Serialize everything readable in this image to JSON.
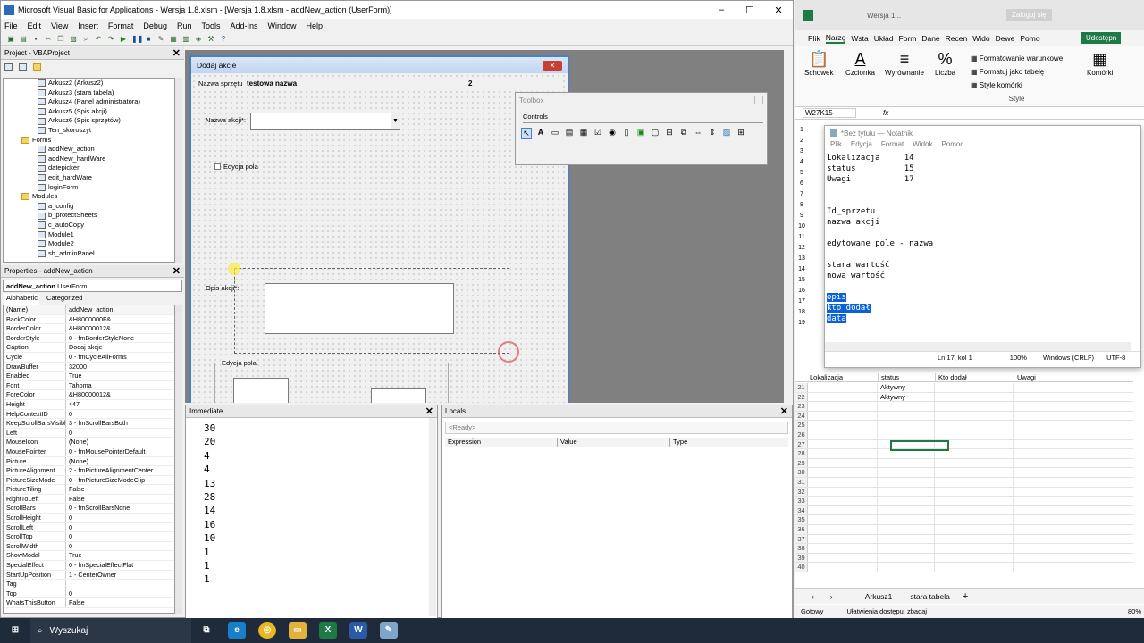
{
  "vba": {
    "title": "Microsoft Visual Basic for Applications - Wersja 1.8.xlsm - [Wersja 1.8.xlsm - addNew_action (UserForm)]",
    "menu": [
      "File",
      "Edit",
      "View",
      "Insert",
      "Format",
      "Debug",
      "Run",
      "Tools",
      "Add-Ins",
      "Window",
      "Help"
    ],
    "project": {
      "title": "Project - VBAProject",
      "items": [
        {
          "label": "Arkusz2 (Arkusz2)",
          "level": 2,
          "folder": false
        },
        {
          "label": "Arkusz3 (stara tabela)",
          "level": 2,
          "folder": false
        },
        {
          "label": "Arkusz4 (Panel administratora)",
          "level": 2,
          "folder": false
        },
        {
          "label": "Arkusz5 (Spis akcji)",
          "level": 2,
          "folder": false
        },
        {
          "label": "Arkusz6 (Spis sprzętów)",
          "level": 2,
          "folder": false
        },
        {
          "label": "Ten_skoroszyt",
          "level": 2,
          "folder": false
        },
        {
          "label": "Forms",
          "level": 1,
          "folder": true
        },
        {
          "label": "addNew_action",
          "level": 2,
          "folder": false
        },
        {
          "label": "addNew_hardWare",
          "level": 2,
          "folder": false
        },
        {
          "label": "datepicker",
          "level": 2,
          "folder": false
        },
        {
          "label": "edit_hardWare",
          "level": 2,
          "folder": false
        },
        {
          "label": "loginForm",
          "level": 2,
          "folder": false
        },
        {
          "label": "Modules",
          "level": 1,
          "folder": true
        },
        {
          "label": "a_config",
          "level": 2,
          "folder": false
        },
        {
          "label": "b_protectSheets",
          "level": 2,
          "folder": false
        },
        {
          "label": "c_autoCopy",
          "level": 2,
          "folder": false
        },
        {
          "label": "Module1",
          "level": 2,
          "folder": false
        },
        {
          "label": "Module2",
          "level": 2,
          "folder": false
        },
        {
          "label": "sh_adminPanel",
          "level": 2,
          "folder": false
        }
      ]
    },
    "properties": {
      "title": "Properties - addNew_action",
      "object_name": "addNew_action",
      "object_type": "UserForm",
      "tabs": [
        "Alphabetic",
        "Categorized"
      ],
      "rows": [
        [
          "(Name)",
          "addNew_action"
        ],
        [
          "BackColor",
          "&H8000000F&"
        ],
        [
          "BorderColor",
          "&H80000012&"
        ],
        [
          "BorderStyle",
          "0 - fmBorderStyleNone"
        ],
        [
          "Caption",
          "Dodaj akcje"
        ],
        [
          "Cycle",
          "0 - fmCycleAllForms"
        ],
        [
          "DrawBuffer",
          "32000"
        ],
        [
          "Enabled",
          "True"
        ],
        [
          "Font",
          "Tahoma"
        ],
        [
          "ForeColor",
          "&H80000012&"
        ],
        [
          "Height",
          "447"
        ],
        [
          "HelpContextID",
          "0"
        ],
        [
          "KeepScrollBarsVisible",
          "3 - fmScrollBarsBoth"
        ],
        [
          "Left",
          "0"
        ],
        [
          "MouseIcon",
          "(None)"
        ],
        [
          "MousePointer",
          "0 - fmMousePointerDefault"
        ],
        [
          "Picture",
          "(None)"
        ],
        [
          "PictureAlignment",
          "2 - fmPictureAlignmentCenter"
        ],
        [
          "PictureSizeMode",
          "0 - fmPictureSizeModeClip"
        ],
        [
          "PictureTiling",
          "False"
        ],
        [
          "RightToLeft",
          "False"
        ],
        [
          "ScrollBars",
          "0 - fmScrollBarsNone"
        ],
        [
          "ScrollHeight",
          "0"
        ],
        [
          "ScrollLeft",
          "0"
        ],
        [
          "ScrollTop",
          "0"
        ],
        [
          "ScrollWidth",
          "0"
        ],
        [
          "ShowModal",
          "True"
        ],
        [
          "SpecialEffect",
          "0 - fmSpecialEffectFlat"
        ],
        [
          "StartUpPosition",
          "1 - CenterOwner"
        ],
        [
          "Tag",
          ""
        ],
        [
          "Top",
          "0"
        ],
        [
          "WhatsThisButton",
          "False"
        ]
      ]
    },
    "form": {
      "caption": "Dodaj akcje",
      "nazwa_sprzetu_label": "Nazwa sprzętu",
      "nazwa_sprzetu_value": "testowa nazwa",
      "number": "2",
      "nazwa_akcji_label": "Nazwa akcji*:",
      "edycja_checkbox": "Edycja pola",
      "opis_label": "Opis akcji*:",
      "edycja_frame": "Edycja pola"
    },
    "toolbox": {
      "title": "Toolbox",
      "tab": "Controls"
    },
    "immediate": {
      "title": "Immediate",
      "lines": [
        "30",
        "20",
        "4",
        "4",
        "13",
        "28",
        "14",
        "16",
        "10",
        "1",
        "1",
        "1"
      ]
    },
    "locals": {
      "title": "Locals",
      "status": "<Ready>",
      "cols": [
        "Expression",
        "Value",
        "Type"
      ]
    }
  },
  "excel": {
    "title": "Wersja 1...",
    "login": "Zaloguj się",
    "tabs": [
      "Plik",
      "Narzę",
      "Wsta",
      "Układ",
      "Form",
      "Dane",
      "Recen",
      "Wido",
      "Dewe",
      "Pomo"
    ],
    "share": "Udostępn",
    "ribbon": {
      "schowek": "Schowek",
      "czcionka": "Czcionka",
      "wyrownanie": "Wyrównanie",
      "liczba": "Liczba",
      "cond": "Formatowanie warunkowe",
      "table": "Formatuj jako tabelę",
      "styles": "Style komórki",
      "style_group": "Style",
      "komorki": "Komórki"
    },
    "namebox": "W27K15",
    "grid_headers": [
      "Lokalizacja",
      "status",
      "Kto dodał",
      "Uwagi"
    ],
    "rows": [
      {
        "n": "21",
        "status": "Aktywny"
      },
      {
        "n": "22",
        "status": "Aktywny"
      },
      {
        "n": "23",
        "status": ""
      },
      {
        "n": "24",
        "status": ""
      },
      {
        "n": "25",
        "status": ""
      },
      {
        "n": "26",
        "status": ""
      },
      {
        "n": "27",
        "status": ""
      },
      {
        "n": "28",
        "status": ""
      },
      {
        "n": "29",
        "status": ""
      },
      {
        "n": "30",
        "status": ""
      },
      {
        "n": "31",
        "status": ""
      },
      {
        "n": "32",
        "status": ""
      },
      {
        "n": "33",
        "status": ""
      },
      {
        "n": "34",
        "status": ""
      },
      {
        "n": "35",
        "status": ""
      },
      {
        "n": "36",
        "status": ""
      },
      {
        "n": "37",
        "status": ""
      },
      {
        "n": "38",
        "status": ""
      },
      {
        "n": "39",
        "status": ""
      },
      {
        "n": "40",
        "status": ""
      }
    ],
    "left_rows": [
      "1",
      "2",
      "3",
      "4",
      "5",
      "6",
      "7",
      "8",
      "9",
      "10",
      "11",
      "12",
      "13",
      "14",
      "15",
      "16",
      "17",
      "18",
      "19"
    ],
    "sheets": [
      "Arkusz1",
      "stara tabela"
    ],
    "status": {
      "ready": "Gotowy",
      "accessibility": "Ułatwienia dostępu: zbadaj",
      "zoom": "80%"
    }
  },
  "notepad": {
    "title": "*Bez tytułu — Notatnik",
    "menu": [
      "Plik",
      "Edycja",
      "Format",
      "Widok",
      "Pomoc"
    ],
    "lines": [
      {
        "t": "Lokalizacja     14",
        "sel": false
      },
      {
        "t": "status          15",
        "sel": false
      },
      {
        "t": "Uwagi           17",
        "sel": false
      },
      {
        "t": "",
        "sel": false
      },
      {
        "t": "",
        "sel": false
      },
      {
        "t": "Id_sprzetu",
        "sel": false
      },
      {
        "t": "nazwa akcji",
        "sel": false
      },
      {
        "t": "",
        "sel": false
      },
      {
        "t": "edytowane pole - nazwa",
        "sel": false
      },
      {
        "t": "",
        "sel": false
      },
      {
        "t": "stara wartość",
        "sel": false
      },
      {
        "t": "nowa wartość",
        "sel": false
      },
      {
        "t": "",
        "sel": false
      },
      {
        "t": "opis",
        "sel": true
      },
      {
        "t": "kto dodał",
        "sel": true
      },
      {
        "t": "data",
        "sel": true
      }
    ],
    "status": {
      "pos": "Ln 17, kol 1",
      "zoom": "100%",
      "eol": "Windows (CRLF)",
      "enc": "UTF-8"
    }
  },
  "taskbar": {
    "search": "Wyszukaj"
  }
}
